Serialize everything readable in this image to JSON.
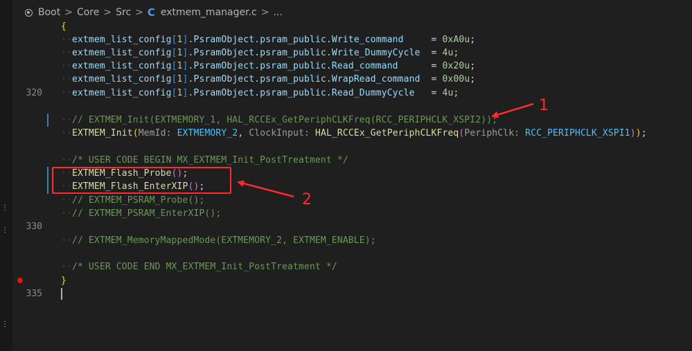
{
  "breadcrumb": {
    "items": [
      "Boot",
      "Core",
      "Src",
      "extmem_manager.c",
      "..."
    ],
    "separator": ">",
    "root_icon": "folder-root-icon",
    "file_icon": "c-file-icon"
  },
  "editor": {
    "line_numbers": {
      "l320": "320",
      "l330": "330",
      "l335": "335"
    },
    "open_brace": "{",
    "close_brace": "}",
    "config_lines": [
      {
        "prefix": "extmem_list_config",
        "index": "1",
        "path": ".PsramObject.psram_public.",
        "field": "Write_command",
        "pad": "    ",
        "value": "0xA0u"
      },
      {
        "prefix": "extmem_list_config",
        "index": "1",
        "path": ".PsramObject.psram_public.",
        "field": "Write_DummyCycle",
        "pad": " ",
        "value": "4u"
      },
      {
        "prefix": "extmem_list_config",
        "index": "1",
        "path": ".PsramObject.psram_public.",
        "field": "Read_command",
        "pad": "     ",
        "value": "0x20u"
      },
      {
        "prefix": "extmem_list_config",
        "index": "1",
        "path": ".PsramObject.psram_public.",
        "field": "WrapRead_command",
        "pad": " ",
        "value": "0x00u"
      },
      {
        "prefix": "extmem_list_config",
        "index": "1",
        "path": ".PsramObject.psram_public.",
        "field": "Read_DummyCycle",
        "pad": "  ",
        "value": "4u"
      }
    ],
    "comment_init_xspi2": "// EXTMEM_Init(EXTMEMORY_1, HAL_RCCEx_GetPeriphCLKFreq(RCC_PERIPHCLK_XSPI2));",
    "init_call": {
      "fn": "EXTMEM_Init",
      "hint_memid": "MemId:",
      "arg1": "EXTMEMORY_2",
      "hint_clock": "ClockInput:",
      "fn2": "HAL_RCCEx_GetPeriphCLKFreq",
      "hint_periph": "PeriphClk:",
      "arg2": "RCC_PERIPHCLK_XSPI1"
    },
    "comment_begin": "/* USER CODE BEGIN MX_EXTMEM_Init_PostTreatment */",
    "flash_probe": "EXTMEM_Flash_Probe",
    "flash_enter_xip": "EXTMEM_Flash_EnterXIP",
    "comment_psram_probe": "// EXTMEM_PSRAM_Probe();",
    "comment_psram_xip": "// EXTMEM_PSRAM_EnterXIP();",
    "comment_memmapped": "// EXTMEM_MemoryMappedMode(EXTMEMORY_2, EXTMEM_ENABLE);",
    "comment_end": "/* USER CODE END MX_EXTMEM_Init_PostTreatment */"
  },
  "annotations": {
    "label1": "1",
    "label2": "2",
    "color": "#ff2b2b"
  },
  "colors": {
    "background": "#1f1f1f",
    "function": "#dcdcaa",
    "variable": "#9cdcfe",
    "constant": "#4fc1ff",
    "number": "#b5cea8",
    "comment": "#6a9955",
    "breakpoint": "#e51400"
  }
}
